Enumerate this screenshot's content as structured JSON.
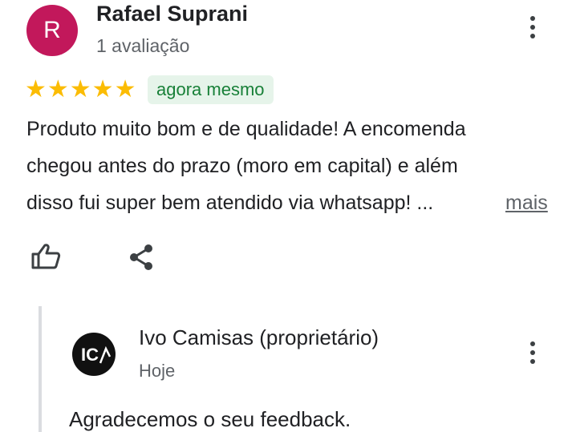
{
  "review": {
    "avatar_letter": "R",
    "avatar_color": "#c2185b",
    "reviewer_name": "Rafael Suprani",
    "review_count": "1 avaliação",
    "rating": 5,
    "stars_text": "★★★★★",
    "star_color": "#fbbc04",
    "time_ago": "agora mesmo",
    "text_lines": [
      "Produto muito bom e de qualidade! A encomenda",
      "chegou antes do prazo (moro em capital) e além",
      "disso fui super bem atendido via whatsapp! ..."
    ],
    "more_label": "mais",
    "menu_icon": "more-vert-icon",
    "like_icon": "thumb-up-icon",
    "share_icon": "share-icon"
  },
  "owner_reply": {
    "owner_name": "Ivo Camisas (proprietário)",
    "date": "Hoje",
    "text": "Agradecemos o seu feedback.",
    "logo_text": "IC",
    "menu_icon": "more-vert-icon"
  }
}
